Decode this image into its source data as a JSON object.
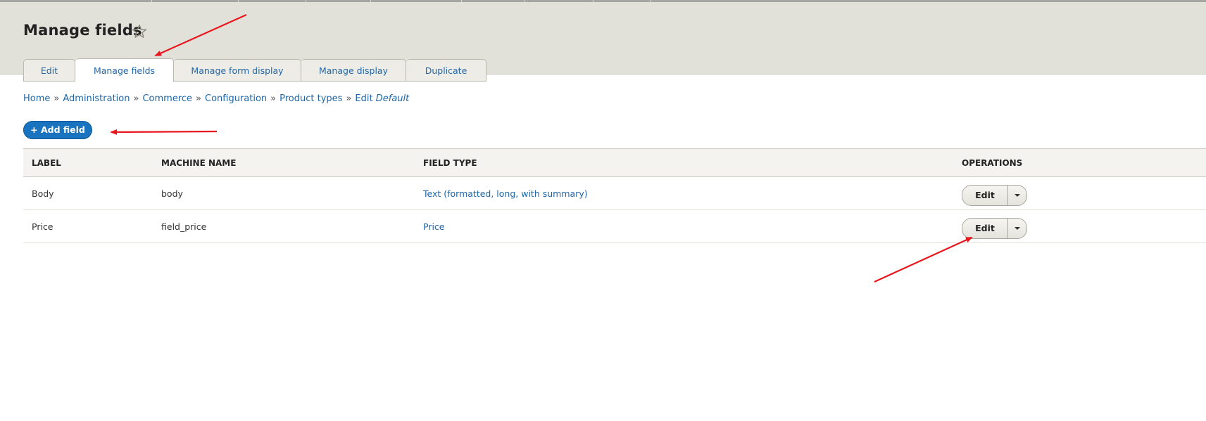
{
  "page": {
    "title": "Manage fields"
  },
  "tabs": [
    {
      "label": "Edit"
    },
    {
      "label": "Manage fields",
      "active": true
    },
    {
      "label": "Manage form display"
    },
    {
      "label": "Manage display"
    },
    {
      "label": "Duplicate"
    }
  ],
  "breadcrumb": {
    "items": [
      "Home",
      "Administration",
      "Commerce",
      "Configuration",
      "Product types"
    ],
    "separator": "»",
    "edit_prefix": "Edit",
    "edit_name": "Default"
  },
  "actions": {
    "add_field_label": "+ Add field"
  },
  "table": {
    "headers": [
      "LABEL",
      "MACHINE NAME",
      "FIELD TYPE",
      "OPERATIONS"
    ],
    "rows": [
      {
        "label": "Body",
        "machine_name": "body",
        "field_type": "Text (formatted, long, with summary)",
        "op_label": "Edit"
      },
      {
        "label": "Price",
        "machine_name": "field_price",
        "field_type": "Price",
        "op_label": "Edit"
      }
    ]
  },
  "colors": {
    "header_bg": "#e1e0d9",
    "link": "#1f66a8",
    "primary_button": "#1a73bf",
    "annotation_arrow": "#e8161d"
  },
  "icons": {
    "favorite": "star-outline-icon",
    "dropbutton": "chevron-down-icon"
  }
}
